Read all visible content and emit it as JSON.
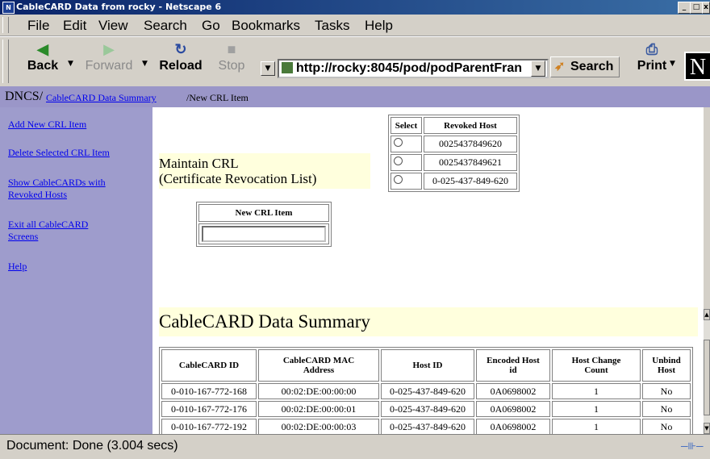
{
  "window": {
    "title": "CableCARD Data from rocky - Netscape 6",
    "app_icon": "N",
    "buttons": {
      "minimize": "_",
      "maximize": "□",
      "close": "x"
    }
  },
  "menu": [
    "File",
    "Edit",
    "View",
    "Search",
    "Go",
    "Bookmarks",
    "Tasks",
    "Help"
  ],
  "toolbar": {
    "back": "Back",
    "forward": "Forward",
    "reload": "Reload",
    "stop": "Stop",
    "url": "http://rocky:8045/pod/podParentFran",
    "search": "Search",
    "print": "Print",
    "logo": "N"
  },
  "breadcrumb": {
    "root": "DNCS",
    "link": "CableCARD Data Summary",
    "current": "New CRL Item"
  },
  "sidebar": {
    "items": [
      {
        "label_lines": [
          "Add New CRL Item"
        ]
      },
      {
        "label_lines": [
          "Delete Selected CRL Item"
        ]
      },
      {
        "label_lines": [
          "Show CableCARDs with",
          "Revoked Hosts"
        ]
      },
      {
        "label_lines": [
          "Exit all CableCARD",
          "Screens"
        ]
      },
      {
        "label_lines": [
          "Help"
        ]
      }
    ]
  },
  "maintain": {
    "line1": "Maintain CRL",
    "line2": "(Certificate Revocation List)"
  },
  "revoked_table": {
    "headers": [
      "Select",
      "Revoked Host"
    ],
    "rows": [
      "0025437849620",
      "0025437849621",
      "0-025-437-849-620"
    ]
  },
  "new_crl": {
    "header": "New CRL Item",
    "value": ""
  },
  "summary": {
    "title": "CableCARD Data Summary",
    "headers": [
      [
        "CableCARD ID"
      ],
      [
        "CableCARD MAC",
        "Address"
      ],
      [
        "Host ID"
      ],
      [
        "Encoded Host",
        "id"
      ],
      [
        "Host Change",
        "Count"
      ],
      [
        "Unbind",
        "Host"
      ]
    ],
    "rows": [
      [
        "0-010-167-772-168",
        "00:02:DE:00:00:00",
        "0-025-437-849-620",
        "0A0698002",
        "1",
        "No"
      ],
      [
        "0-010-167-772-176",
        "00:02:DE:00:00:01",
        "0-025-437-849-620",
        "0A0698002",
        "1",
        "No"
      ],
      [
        "0-010-167-772-192",
        "00:02:DE:00:00:03",
        "0-025-437-849-620",
        "0A0698002",
        "1",
        "No"
      ]
    ]
  },
  "status": {
    "text": "Document: Done (3.004 secs)"
  },
  "colors": {
    "sidebar": "#9e9ccc",
    "breadcrumb": "#9a96c8",
    "highlight": "#ffffdd",
    "link": "#0000ee"
  }
}
